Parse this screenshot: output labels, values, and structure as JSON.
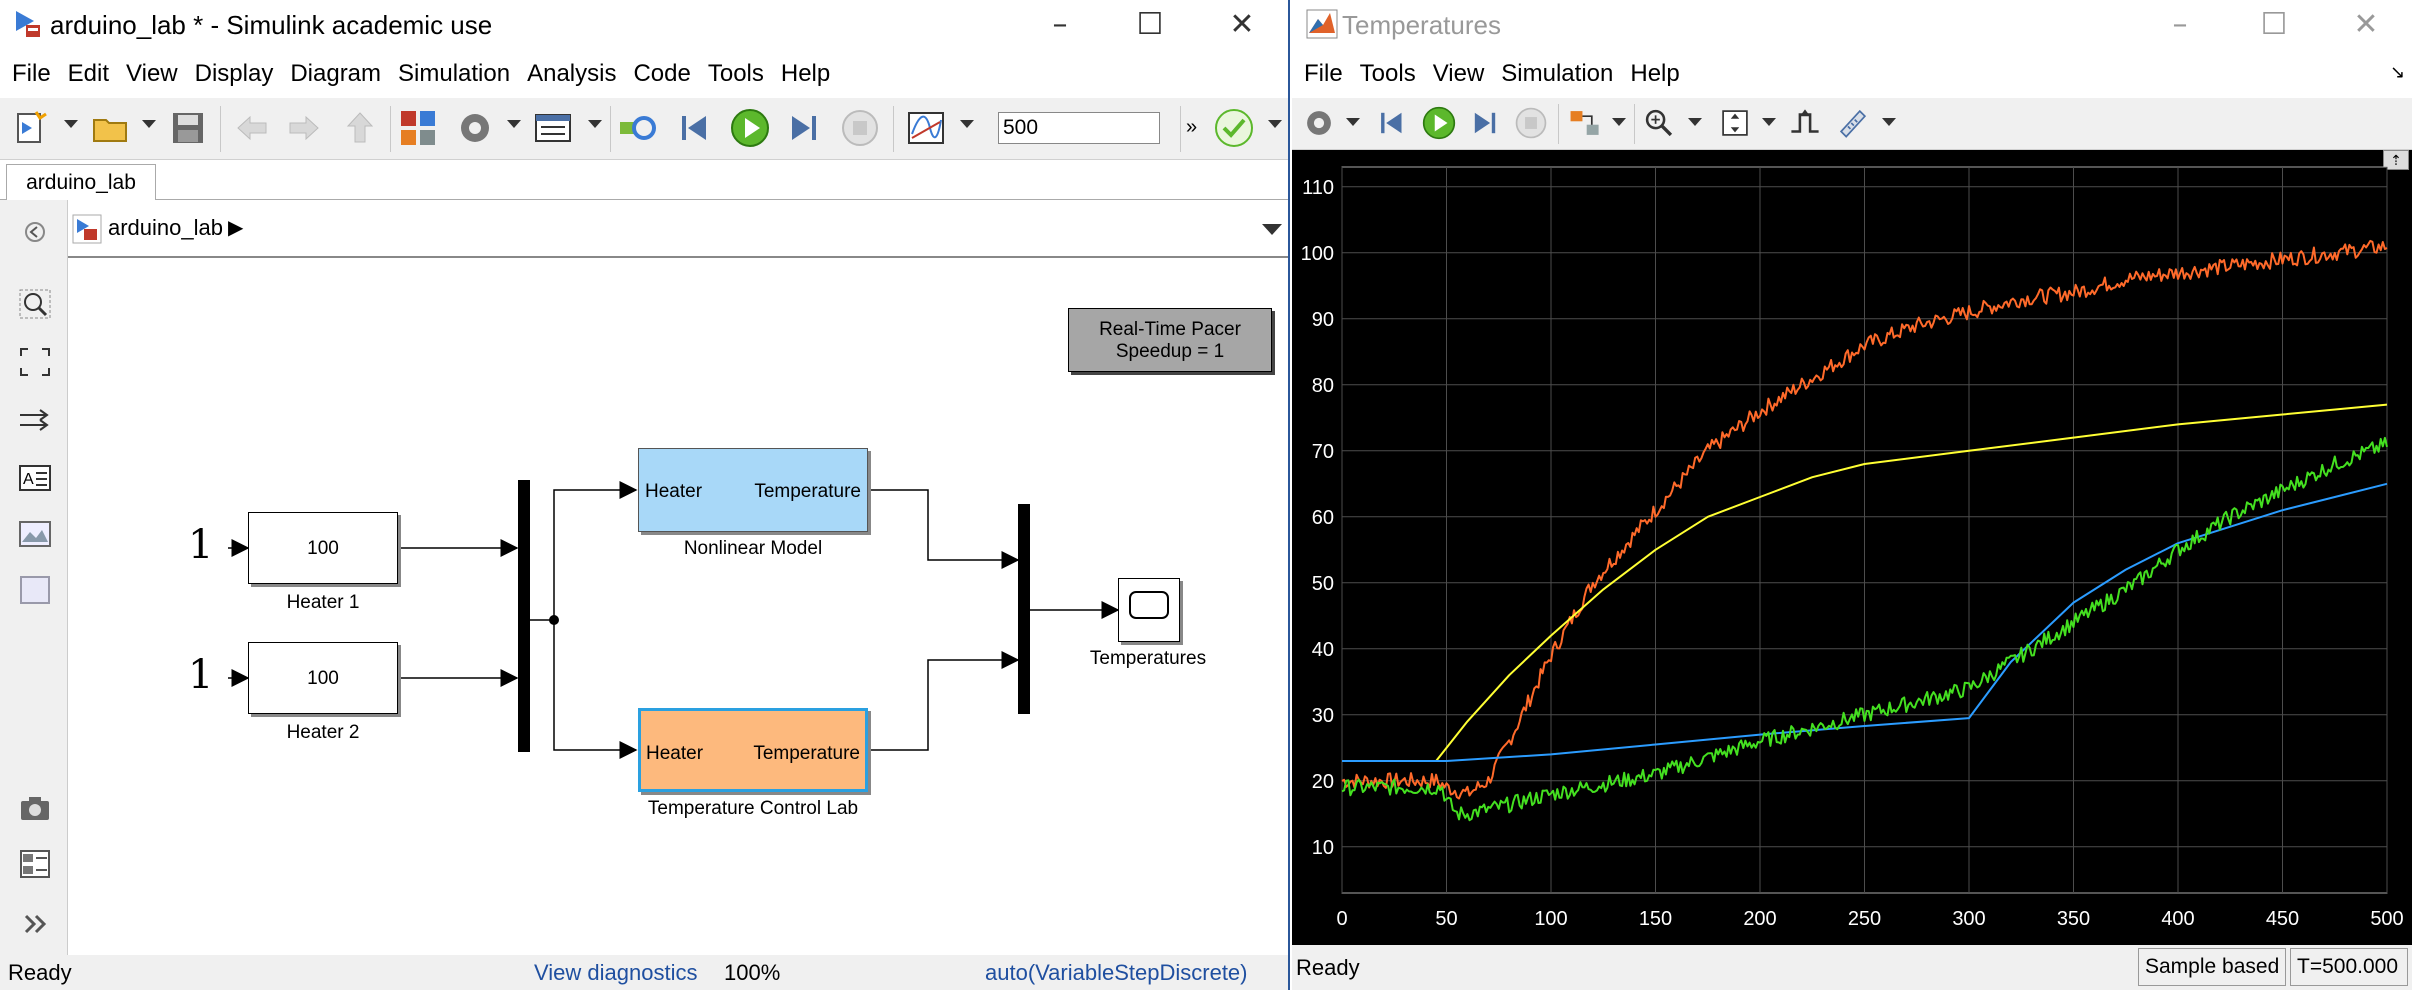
{
  "simulink": {
    "window_title": "arduino_lab * - Simulink academic use",
    "menu": [
      "File",
      "Edit",
      "View",
      "Display",
      "Diagram",
      "Simulation",
      "Analysis",
      "Code",
      "Tools",
      "Help"
    ],
    "stop_time": "500",
    "overflow_chevron": "»",
    "tab_label": "arduino_lab",
    "breadcrumb": "arduino_lab",
    "blocks": {
      "pacer_line1": "Real-Time Pacer",
      "pacer_line2": "Speedup = 1",
      "const1_value": "1",
      "const2_value": "1",
      "heater1_value": "100",
      "heater1_label": "Heater 1",
      "heater2_value": "100",
      "heater2_label": "Heater 2",
      "model_in_port": "Heater",
      "model_out_port": "Temperature",
      "model_label": "Nonlinear Model",
      "tcl_in_port": "Heater",
      "tcl_out_port": "Temperature",
      "tcl_label": "Temperature Control Lab",
      "scope_label": "Temperatures"
    },
    "status": {
      "left": "Ready",
      "diagnostics": "View diagnostics",
      "zoom": "100%",
      "solver": "auto(VariableStepDiscrete)"
    },
    "colors": {
      "model_block": "#a8d8f8",
      "tcl_block": "#fdb97d",
      "link_text": "#1f4fa0"
    }
  },
  "scope": {
    "window_title": "Temperatures",
    "menu": [
      "File",
      "Tools",
      "View",
      "Simulation",
      "Help"
    ],
    "status_left": "Ready",
    "status_sample": "Sample based",
    "status_time": "T=500.000",
    "colors": {
      "background": "#000000",
      "grid": "#4d4d4d",
      "axis_text": "#ffffff"
    }
  },
  "chart_data": {
    "type": "line",
    "title": "",
    "xlabel": "",
    "ylabel": "",
    "xlim": [
      0,
      500
    ],
    "ylim": [
      3,
      113
    ],
    "xticks": [
      0,
      50,
      100,
      150,
      200,
      250,
      300,
      350,
      400,
      450,
      500
    ],
    "yticks": [
      10,
      20,
      30,
      40,
      50,
      60,
      70,
      80,
      90,
      100,
      110
    ],
    "grid": true,
    "series": [
      {
        "color": "#ff6a2a",
        "noisy": true,
        "x": [
          0,
          45,
          50,
          60,
          70,
          80,
          100,
          120,
          150,
          175,
          200,
          225,
          250,
          275,
          300,
          325,
          350,
          375,
          400,
          425,
          450,
          475,
          500
        ],
        "y": [
          20,
          20,
          19,
          18,
          20,
          26,
          39,
          50,
          61,
          70,
          76,
          81,
          86,
          89,
          91,
          93,
          94,
          96,
          97,
          98,
          99,
          100,
          101
        ]
      },
      {
        "color": "#ffff33",
        "noisy": false,
        "x": [
          0,
          40,
          45,
          60,
          80,
          100,
          125,
          150,
          175,
          200,
          225,
          250,
          300,
          350,
          400,
          450,
          500
        ],
        "y": [
          23,
          23,
          23,
          29,
          36,
          42,
          49,
          55,
          60,
          63,
          66,
          68,
          70,
          72,
          74,
          75.5,
          77
        ]
      },
      {
        "color": "#2b9cff",
        "noisy": false,
        "x": [
          0,
          50,
          100,
          150,
          200,
          250,
          300,
          320,
          350,
          375,
          400,
          425,
          450,
          475,
          500
        ],
        "y": [
          23,
          23,
          24,
          25.5,
          27,
          28.3,
          29.5,
          38,
          47,
          52,
          56,
          58.5,
          61,
          63,
          65
        ]
      },
      {
        "color": "#44e020",
        "noisy": true,
        "x": [
          0,
          48,
          50,
          55,
          60,
          75,
          100,
          125,
          150,
          175,
          200,
          225,
          250,
          275,
          300,
          320,
          340,
          360,
          380,
          400,
          425,
          450,
          475,
          500
        ],
        "y": [
          19,
          19,
          17,
          15,
          15,
          16,
          18,
          19.5,
          21,
          23.5,
          26,
          28,
          30,
          32,
          34,
          38,
          42,
          46,
          50,
          55,
          60,
          64,
          68,
          71
        ]
      }
    ]
  }
}
